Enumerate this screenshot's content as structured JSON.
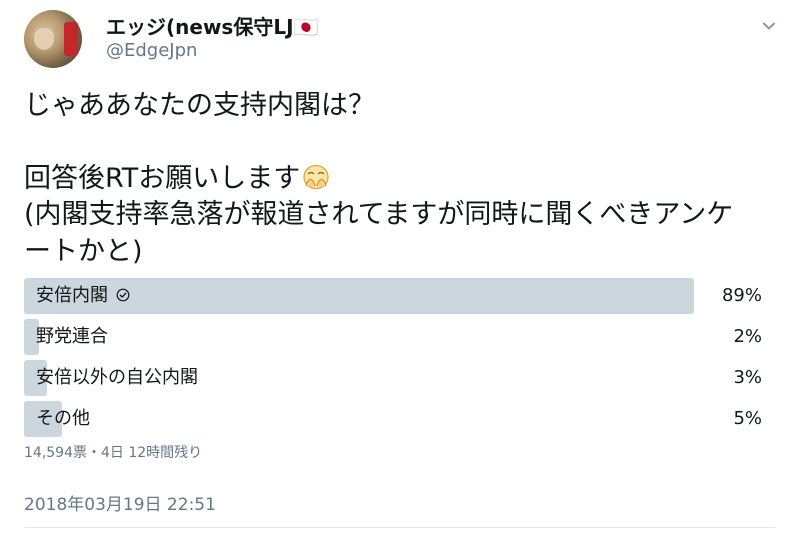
{
  "author": {
    "name": "エッジ(news保守LJ🇯🇵",
    "handle": "@EdgeJpn"
  },
  "tweet": {
    "lines": [
      "じゃああなたの支持内閣は？",
      "",
      "回答後RTお願いします",
      "(内閣支持率急落が報道されてますが同時に聞くべきアンケ",
      "ートかと)"
    ],
    "emoji": "hands-over-face-emoji"
  },
  "poll": {
    "options": [
      {
        "label": "安倍内閣",
        "percent": 89,
        "percent_label": "89%",
        "winner": true
      },
      {
        "label": "野党連合",
        "percent": 2,
        "percent_label": "2%",
        "winner": false
      },
      {
        "label": "安倍以外の自公内閣",
        "percent": 3,
        "percent_label": "3%",
        "winner": false
      },
      {
        "label": "その他",
        "percent": 5,
        "percent_label": "5%",
        "winner": false
      }
    ],
    "meta": "14,594票・4日 12時間残り"
  },
  "timestamp": "2018年03月19日 22:51",
  "colors": {
    "bar": "#ccd6dd",
    "secondary_text": "#657786",
    "primary_text": "#14171a"
  }
}
